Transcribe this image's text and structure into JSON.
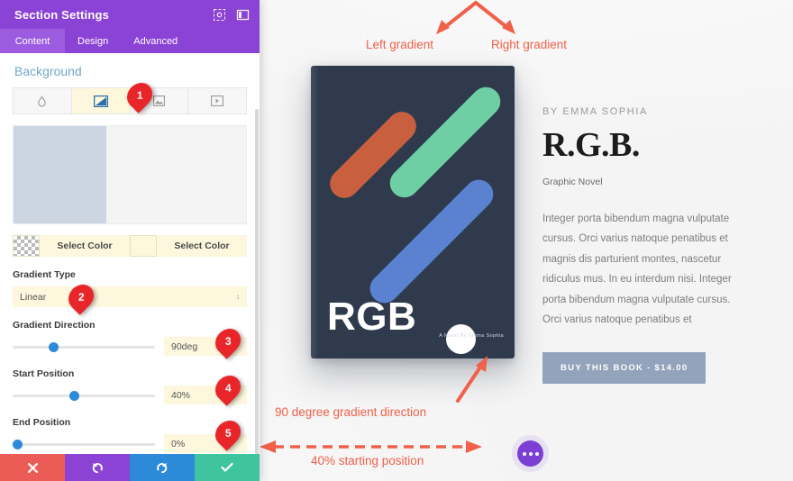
{
  "panel": {
    "title": "Section Settings",
    "header_icons": [
      "target-icon",
      "layout-icon"
    ],
    "tabs": [
      {
        "label": "Content",
        "active": true
      },
      {
        "label": "Design",
        "active": false
      },
      {
        "label": "Advanced",
        "active": false
      }
    ],
    "section_title": "Background",
    "background_types": [
      {
        "icon": "color-droplet-icon",
        "active": false
      },
      {
        "icon": "gradient-icon",
        "active": true
      },
      {
        "icon": "image-icon",
        "active": false
      },
      {
        "icon": "video-icon",
        "active": false
      }
    ],
    "gradient_preview": {
      "left_color": "#ccd6e3",
      "right_color": "#f4f4f4",
      "split_percent": 40
    },
    "color_row": {
      "left_swatch": "transparent-checker",
      "left_label": "Select Color",
      "right_swatch": "#fcf7dd",
      "right_label": "Select Color"
    },
    "fields": {
      "gradient_type": {
        "label": "Gradient Type",
        "value": "Linear",
        "caret": "↕"
      },
      "gradient_direction": {
        "label": "Gradient Direction",
        "value": "90deg",
        "slider_percent": 25
      },
      "start_position": {
        "label": "Start Position",
        "value": "40%",
        "slider_percent": 40
      },
      "end_position": {
        "label": "End Position",
        "value": "0%",
        "slider_percent": 0
      }
    },
    "footer_buttons": [
      {
        "name": "close",
        "icon": "x-icon",
        "color": "#ec5c57"
      },
      {
        "name": "undo",
        "icon": "undo-icon",
        "color": "#8b43d6"
      },
      {
        "name": "redo",
        "icon": "redo-icon",
        "color": "#2d8ad8"
      },
      {
        "name": "save",
        "icon": "check-icon",
        "color": "#3fc4a0"
      }
    ],
    "markers": [
      "1",
      "2",
      "3",
      "4",
      "5"
    ]
  },
  "annotations": {
    "color": "#f0604a",
    "left_gradient": "Left gradient",
    "right_gradient": "Right gradient",
    "direction": "90 degree gradient direction",
    "start_position": "40% starting position"
  },
  "preview": {
    "book": {
      "title": "RGB",
      "subtitle": "A Novel By Emma Sophia",
      "cover_color": "#2f3b4d",
      "stripe_colors": [
        "#c8603f",
        "#6ecfa5",
        "#5b82d1"
      ]
    },
    "detail": {
      "author": "BY EMMA SOPHIA",
      "title": "R.G.B.",
      "genre": "Graphic Novel",
      "body": "Integer porta bibendum magna vulputate cursus. Orci varius natoque penatibus et magnis dis parturient montes, nascetur ridiculus mus. In eu interdum nisi. Integer porta bibendum magna vulputate cursus. Orci varius natoque penatibus et",
      "buy_button": "BUY THIS BOOK - $14.00"
    },
    "fab_icon": "more-options-icon"
  }
}
